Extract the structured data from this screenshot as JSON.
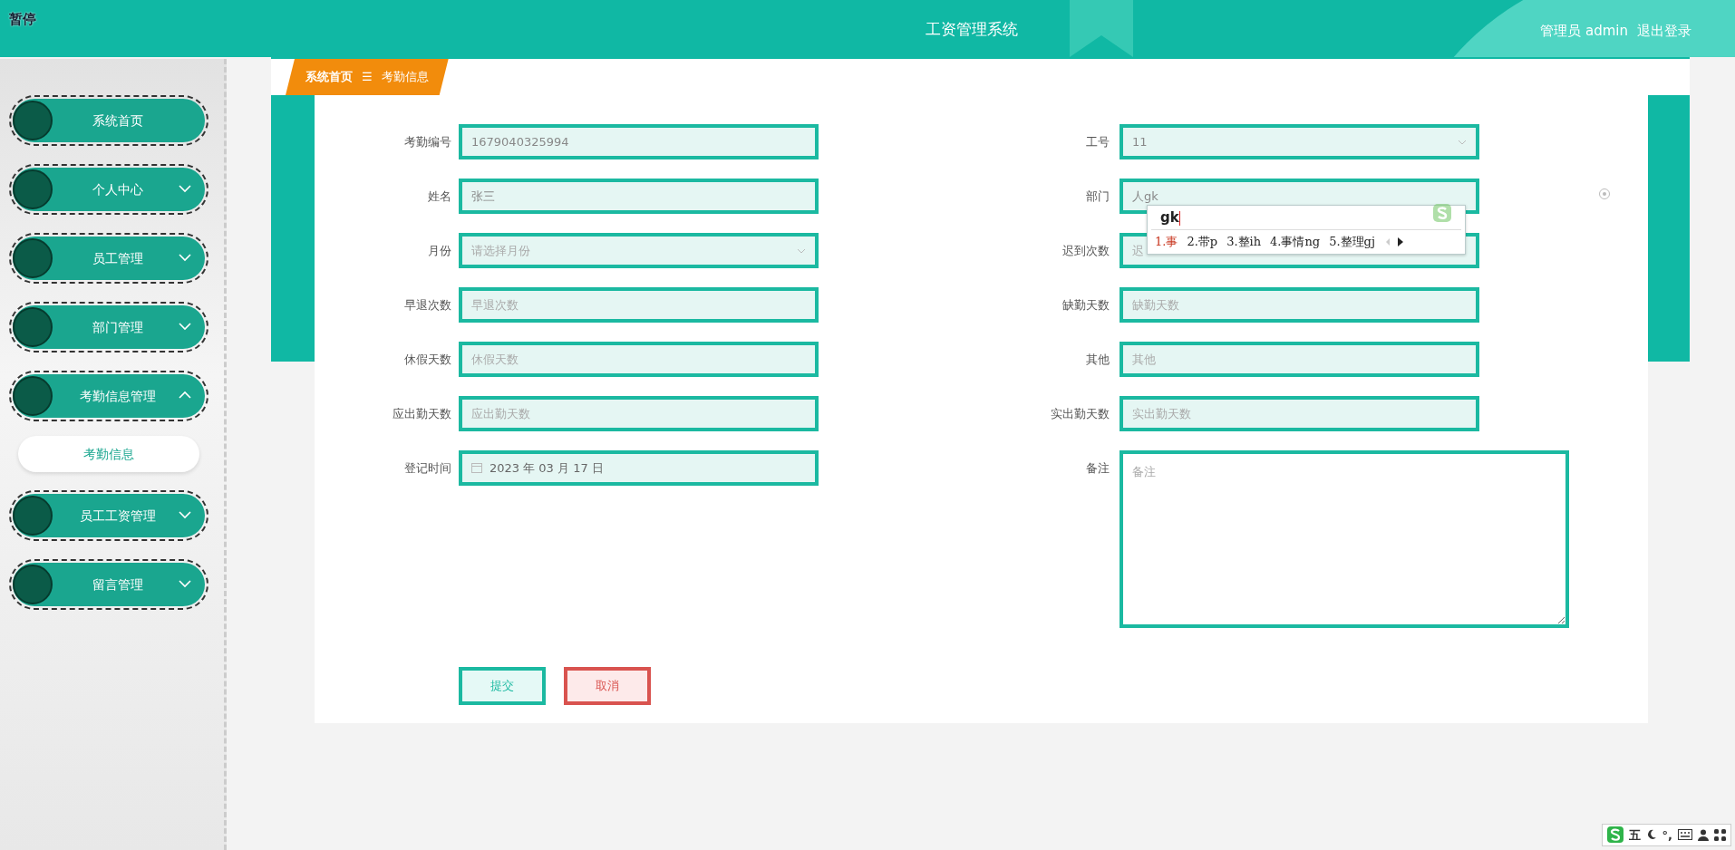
{
  "pause_label": "暂停",
  "header": {
    "title": "工资管理系统",
    "user": "管理员 admin",
    "logout": "退出登录"
  },
  "sidebar": {
    "items": [
      {
        "label": "系统首页",
        "kind": "link"
      },
      {
        "label": "个人中心",
        "kind": "menu",
        "expanded": false
      },
      {
        "label": "员工管理",
        "kind": "menu",
        "expanded": false
      },
      {
        "label": "部门管理",
        "kind": "menu",
        "expanded": false
      },
      {
        "label": "考勤信息管理",
        "kind": "menu",
        "expanded": true,
        "children": [
          {
            "label": "考勤信息",
            "selected": true
          }
        ]
      },
      {
        "label": "员工工资管理",
        "kind": "menu",
        "expanded": false
      },
      {
        "label": "留言管理",
        "kind": "menu",
        "expanded": false
      }
    ]
  },
  "breadcrumb": {
    "items": [
      "系统首页",
      "考勤信息"
    ],
    "separator": "☰"
  },
  "form": {
    "left_fields": [
      {
        "label": "考勤编号",
        "kind": "input",
        "value": "1679040325994"
      },
      {
        "label": "姓名",
        "kind": "input",
        "value": "张三"
      },
      {
        "label": "月份",
        "kind": "select",
        "placeholder": "请选择月份"
      },
      {
        "label": "早退次数",
        "kind": "input",
        "placeholder": "早退次数"
      },
      {
        "label": "休假天数",
        "kind": "input",
        "placeholder": "休假天数"
      },
      {
        "label": "应出勤天数",
        "kind": "input",
        "placeholder": "应出勤天数"
      },
      {
        "label": "登记时间",
        "kind": "date",
        "value": "2023 年 03 月 17 日"
      }
    ],
    "right_fields": [
      {
        "label": "工号",
        "kind": "select",
        "value": "11"
      },
      {
        "label": "部门",
        "kind": "input",
        "value": "人gk"
      },
      {
        "label": "迟到次数",
        "kind": "input",
        "placeholder": "迟"
      },
      {
        "label": "缺勤天数",
        "kind": "input",
        "placeholder": "缺勤天数"
      },
      {
        "label": "其他",
        "kind": "input",
        "placeholder": "其他"
      },
      {
        "label": "实出勤天数",
        "kind": "input",
        "placeholder": "实出勤天数"
      },
      {
        "label": "备注",
        "kind": "textarea",
        "placeholder": "备注"
      }
    ],
    "buttons": [
      {
        "label": "提交",
        "kind": "primary"
      },
      {
        "label": "取消",
        "kind": "danger"
      }
    ]
  },
  "ime_popup": {
    "composition": "gk",
    "candidates": [
      {
        "label": "1.事",
        "selected": true
      },
      {
        "label": "2.带p",
        "selected": false
      },
      {
        "label": "3.整ih",
        "selected": false
      },
      {
        "label": "4.事情ng",
        "selected": false
      },
      {
        "label": "5.整理gj",
        "selected": false
      }
    ]
  },
  "ime_toolbar": {
    "mode": "五",
    "punctuation": "°,"
  }
}
